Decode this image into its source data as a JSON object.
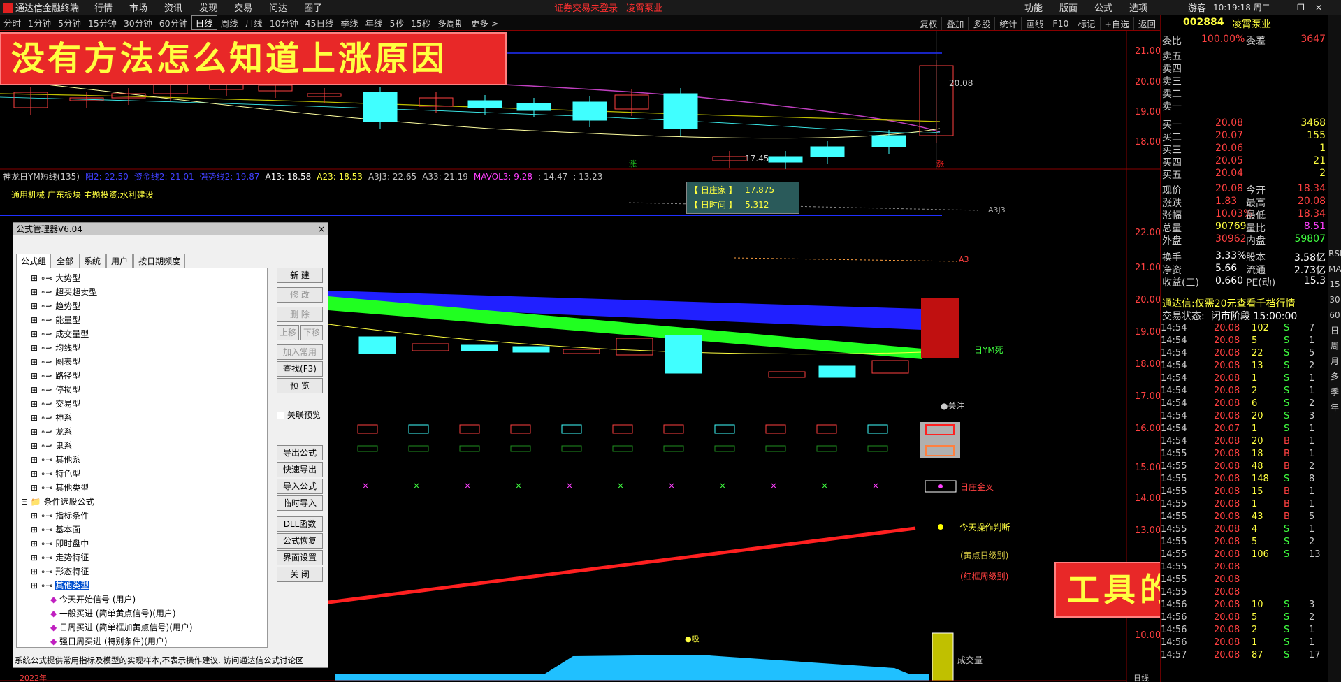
{
  "window": {
    "app_name": "通达信金融终端",
    "menus": [
      "行情",
      "市场",
      "资讯",
      "发现",
      "交易",
      "问达",
      "圈子"
    ],
    "login_warning": "证券交易未登录",
    "stock_title": "凌霄泵业",
    "right_menus": [
      "功能",
      "版面",
      "公式",
      "选项"
    ],
    "user": "游客",
    "clock": "10:19:18 周二"
  },
  "periods": [
    "分时",
    "1分钟",
    "5分钟",
    "15分钟",
    "30分钟",
    "60分钟",
    "日线",
    "周线",
    "月线",
    "10分钟",
    "45日线",
    "季线",
    "年线",
    "5秒",
    "15秒",
    "多周期",
    "更多 >"
  ],
  "active_period": "日线",
  "tools": [
    "复权",
    "叠加",
    "多股",
    "统计",
    "画线",
    "F10",
    "标记",
    "+自选",
    "返回"
  ],
  "banner_top": "没有方法怎么知道上涨原因",
  "banner_bottom": "工具的重要性",
  "main_chart": {
    "high_label": "20.08",
    "low_label": "17.45",
    "tag_left": "涨",
    "tag_right": "涨",
    "y_ticks": [
      "21.00",
      "20.00",
      "19.00",
      "18.00"
    ]
  },
  "indicator": {
    "line": "神龙日YM短线(135)",
    "values": [
      {
        "t": "阳2: 22.50",
        "c": "#4040ff"
      },
      {
        "t": "资金线2: 21.01",
        "c": "#4040ff"
      },
      {
        "t": "强势线2: 19.87",
        "c": "#4040ff"
      },
      {
        "t": "A13: 18.58",
        "c": "#ffffff"
      },
      {
        "t": "A23: 18.53",
        "c": "#ffff40"
      },
      {
        "t": "A3J3: 22.65",
        "c": "#c0c0c0"
      },
      {
        "t": "A33: 21.19",
        "c": "#c0c0c0"
      },
      {
        "t": "MAVOL3: 9.28",
        "c": "#ff40ff"
      },
      {
        "t": ": 14.47",
        "c": "#c0c0c0"
      },
      {
        "t": ": 13.23",
        "c": "#c0c0c0"
      }
    ],
    "sector": "通用机械 广东板块 主题投资:水利建设",
    "y_ticks": [
      "22.00",
      "21.00",
      "20.00",
      "19.00",
      "18.00",
      "17.00",
      "16.00",
      "15.00",
      "14.00",
      "13.00",
      "10.00"
    ],
    "popup_l1": "【 日庄家 】",
    "popup_v1": "17.875",
    "popup_l2": "【 日时间 】",
    "popup_v2": "5.312",
    "labels": {
      "a3j3": "A3J3",
      "a3": "A3",
      "ym": "日YM死",
      "attention": "●关注",
      "golden": "日庄金叉",
      "judge": "----今天操作判断",
      "yellow": "(黄点日级别)",
      "red": "(红框周级别)",
      "vol": "成交量",
      "buy": "●吸"
    },
    "bottom_year": "2022年",
    "bottom_right": "日线"
  },
  "dialog": {
    "title": "公式管理器V6.04",
    "close": "×",
    "tabs": [
      "公式组",
      "全部",
      "系统",
      "用户",
      "按日期频度"
    ],
    "tree": [
      {
        "t": "大势型",
        "lv": 1
      },
      {
        "t": "超买超卖型",
        "lv": 1
      },
      {
        "t": "趋势型",
        "lv": 1
      },
      {
        "t": "能量型",
        "lv": 1
      },
      {
        "t": "成交量型",
        "lv": 1
      },
      {
        "t": "均线型",
        "lv": 1
      },
      {
        "t": "图表型",
        "lv": 1
      },
      {
        "t": "路径型",
        "lv": 1
      },
      {
        "t": "停损型",
        "lv": 1
      },
      {
        "t": "交易型",
        "lv": 1
      },
      {
        "t": "神系",
        "lv": 1
      },
      {
        "t": "龙系",
        "lv": 1
      },
      {
        "t": "鬼系",
        "lv": 1
      },
      {
        "t": "其他系",
        "lv": 1
      },
      {
        "t": "特色型",
        "lv": 1
      },
      {
        "t": "其他类型",
        "lv": 1
      },
      {
        "t": "条件选股公式",
        "lv": 0
      },
      {
        "t": "指标条件",
        "lv": 1
      },
      {
        "t": "基本面",
        "lv": 1
      },
      {
        "t": "即时盘中",
        "lv": 1
      },
      {
        "t": "走势特征",
        "lv": 1
      },
      {
        "t": "形态特征",
        "lv": 1
      },
      {
        "t": "其他类型",
        "lv": 1,
        "sel": true
      },
      {
        "t": "今天开始信号 (用户)",
        "lv": 2
      },
      {
        "t": "一般买进  (简单黄点信号)(用户)",
        "lv": 2
      },
      {
        "t": "日周买进  (简单框加黄点信号)(用户)",
        "lv": 2
      },
      {
        "t": "强日周买进  (特别条件)(用户)",
        "lv": 2
      }
    ],
    "buttons": [
      {
        "t": "新 建",
        "d": false
      },
      {
        "t": "修 改",
        "d": true
      },
      {
        "t": "删 除",
        "d": true
      },
      {
        "t": "上移",
        "d": true
      },
      {
        "t": "下移",
        "d": true
      },
      {
        "t": "加入常用",
        "d": true
      },
      {
        "t": "查找(F3)",
        "d": false
      },
      {
        "t": "预 览",
        "d": false
      },
      {
        "t": "导出公式",
        "d": false
      },
      {
        "t": "快速导出",
        "d": false
      },
      {
        "t": "导入公式",
        "d": false
      },
      {
        "t": "临时导入",
        "d": false
      },
      {
        "t": "DLL函数",
        "d": false
      },
      {
        "t": "公式恢复",
        "d": false
      },
      {
        "t": "界面设置",
        "d": false
      },
      {
        "t": "关 闭",
        "d": false
      }
    ],
    "checkbox": "关联预览",
    "status": "系统公式提供常用指标及模型的实现样本,不表示操作建议.   访问通达信公式讨论区"
  },
  "panel": {
    "code": "002884",
    "name": "凌霄泵业",
    "weibi_l": "委比",
    "weibi_v": "100.00%",
    "weicha_l": "委差",
    "weicha_v": "3647",
    "sells": [
      "卖五",
      "卖四",
      "卖三",
      "卖二",
      "卖一"
    ],
    "buys": [
      {
        "l": "买一",
        "p": "20.08",
        "v": "3468"
      },
      {
        "l": "买二",
        "p": "20.07",
        "v": "155"
      },
      {
        "l": "买三",
        "p": "20.06",
        "v": "1"
      },
      {
        "l": "买四",
        "p": "20.05",
        "v": "21"
      },
      {
        "l": "买五",
        "p": "20.04",
        "v": "2"
      }
    ],
    "stats": [
      {
        "l1": "现价",
        "v1": "20.08",
        "l2": "今开",
        "v2": "18.34",
        "c1": "#ff4040",
        "c2": "#ff4040"
      },
      {
        "l1": "涨跌",
        "v1": "1.83",
        "l2": "最高",
        "v2": "20.08",
        "c1": "#ff4040",
        "c2": "#ff4040"
      },
      {
        "l1": "涨幅",
        "v1": "10.03%",
        "l2": "最低",
        "v2": "18.34",
        "c1": "#ff4040",
        "c2": "#ff4040"
      },
      {
        "l1": "总量",
        "v1": "90769",
        "l2": "量比",
        "v2": "8.51",
        "c1": "#ffff40",
        "c2": "#ff40ff"
      },
      {
        "l1": "外盘",
        "v1": "30962",
        "l2": "内盘",
        "v2": "59807",
        "c1": "#ff4040",
        "c2": "#40ff40"
      },
      {
        "l1": "换手",
        "v1": "3.33%",
        "l2": "股本",
        "v2": "3.58亿",
        "c1": "#ffffff",
        "c2": "#ffffff"
      },
      {
        "l1": "净资",
        "v1": "5.66",
        "l2": "流通",
        "v2": "2.73亿",
        "c1": "#ffffff",
        "c2": "#ffffff"
      },
      {
        "l1": "收益(三)",
        "v1": "0.660",
        "l2": "PE(动)",
        "v2": "15.3",
        "c1": "#ffffff",
        "c2": "#ffffff"
      }
    ],
    "ad": "通达信:仅需20元查看千档行情",
    "state_l": "交易状态:",
    "state_v": "闭市阶段 15:00:00",
    "trades": [
      [
        "14:54",
        "20.08",
        "102",
        "S",
        "7"
      ],
      [
        "14:54",
        "20.08",
        "5",
        "S",
        "1"
      ],
      [
        "14:54",
        "20.08",
        "22",
        "S",
        "5"
      ],
      [
        "14:54",
        "20.08",
        "13",
        "S",
        "2"
      ],
      [
        "14:54",
        "20.08",
        "1",
        "S",
        "1"
      ],
      [
        "14:54",
        "20.08",
        "2",
        "S",
        "1"
      ],
      [
        "14:54",
        "20.08",
        "6",
        "S",
        "2"
      ],
      [
        "14:54",
        "20.08",
        "20",
        "S",
        "3"
      ],
      [
        "14:54",
        "20.07",
        "1",
        "S",
        "1"
      ],
      [
        "14:54",
        "20.08",
        "20",
        "B",
        "1"
      ],
      [
        "14:55",
        "20.08",
        "18",
        "B",
        "1"
      ],
      [
        "14:55",
        "20.08",
        "48",
        "B",
        "2"
      ],
      [
        "14:55",
        "20.08",
        "148",
        "S",
        "8"
      ],
      [
        "14:55",
        "20.08",
        "15",
        "B",
        "1"
      ],
      [
        "14:55",
        "20.08",
        "1",
        "B",
        "1"
      ],
      [
        "14:55",
        "20.08",
        "43",
        "B",
        "5"
      ],
      [
        "14:55",
        "20.08",
        "4",
        "S",
        "1"
      ],
      [
        "14:55",
        "20.08",
        "5",
        "S",
        "2"
      ],
      [
        "14:55",
        "20.08",
        "106",
        "S",
        "13"
      ],
      [
        "14:55",
        "20.08",
        "",
        "",
        ""
      ],
      [
        "14:55",
        "20.08",
        "",
        "",
        ""
      ],
      [
        "14:55",
        "20.08",
        "",
        "",
        ""
      ],
      [
        "14:56",
        "20.08",
        "10",
        "S",
        "3"
      ],
      [
        "14:56",
        "20.08",
        "5",
        "S",
        "2"
      ],
      [
        "14:56",
        "20.08",
        "2",
        "S",
        "1"
      ],
      [
        "14:56",
        "20.08",
        "1",
        "S",
        "1"
      ],
      [
        "14:57",
        "20.08",
        "87",
        "S",
        "17"
      ]
    ]
  },
  "sidebar": [
    "RSI",
    "MA",
    "15",
    "30",
    "60",
    "日",
    "周",
    "月",
    "多",
    "季",
    "年"
  ]
}
